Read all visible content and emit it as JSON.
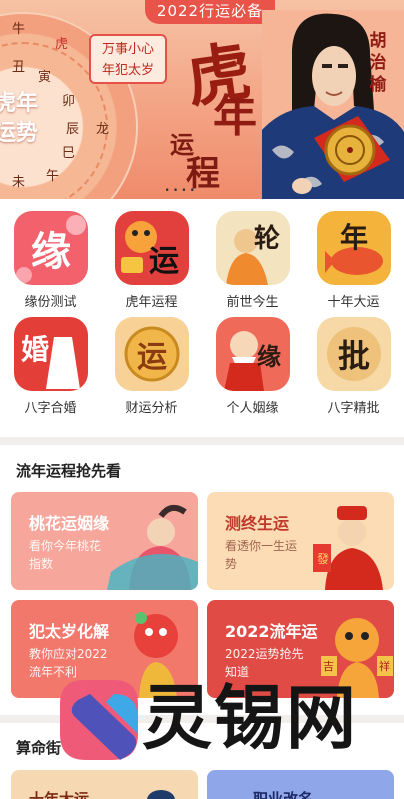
{
  "banner": {
    "tag": "2022行运必备",
    "wheel_chars": [
      "牛",
      "虎",
      "丑",
      "寅",
      "卯",
      "辰",
      "巳",
      "午",
      "未",
      "龙"
    ],
    "wheel_title_line1": "虎年",
    "wheel_title_line2": "运势",
    "slogan_line1": "万事小心",
    "slogan_line2": "年犯太岁",
    "calligraphy_tiger": "虎",
    "calligraphy_year": "年",
    "calligraphy_yun": "运",
    "calligraphy_cheng": "程",
    "dots": "....",
    "signature": "胡治榆"
  },
  "grid": [
    {
      "label": "缘份测试",
      "glyph": "缘"
    },
    {
      "label": "虎年运程",
      "glyph": "运"
    },
    {
      "label": "前世今生",
      "glyph": "轮"
    },
    {
      "label": "十年大运",
      "glyph": "年"
    },
    {
      "label": "八字合婚",
      "glyph": "婚"
    },
    {
      "label": "财运分析",
      "glyph": "运"
    },
    {
      "label": "个人姻缘",
      "glyph": "缘"
    },
    {
      "label": "八字精批",
      "glyph": "批"
    }
  ],
  "liunian": {
    "title": "流年运程抢先看",
    "cards": [
      {
        "title": "桃花运姻缘",
        "sub": "看你今年桃花指数"
      },
      {
        "title": "测终生运",
        "sub": "看透你一生运势"
      },
      {
        "title": "犯太岁化解",
        "sub": "教你应对2022流年不利"
      },
      {
        "title": "2022流年运",
        "sub": "2022运势抢先知道"
      }
    ],
    "couplet_chars": [
      "吉",
      "祥",
      "發"
    ]
  },
  "suanming": {
    "title": "算命街",
    "cards": [
      {
        "title": "十年大运"
      },
      {
        "title": "职业改名"
      }
    ]
  },
  "watermark": {
    "text": "灵锡网"
  },
  "colors": {
    "banner_tag": "#e8544a",
    "promo_peach": "#f6a69a",
    "promo_cream": "#fbdcb4",
    "promo_coral": "#f2786c",
    "promo_red": "#e04b45"
  }
}
